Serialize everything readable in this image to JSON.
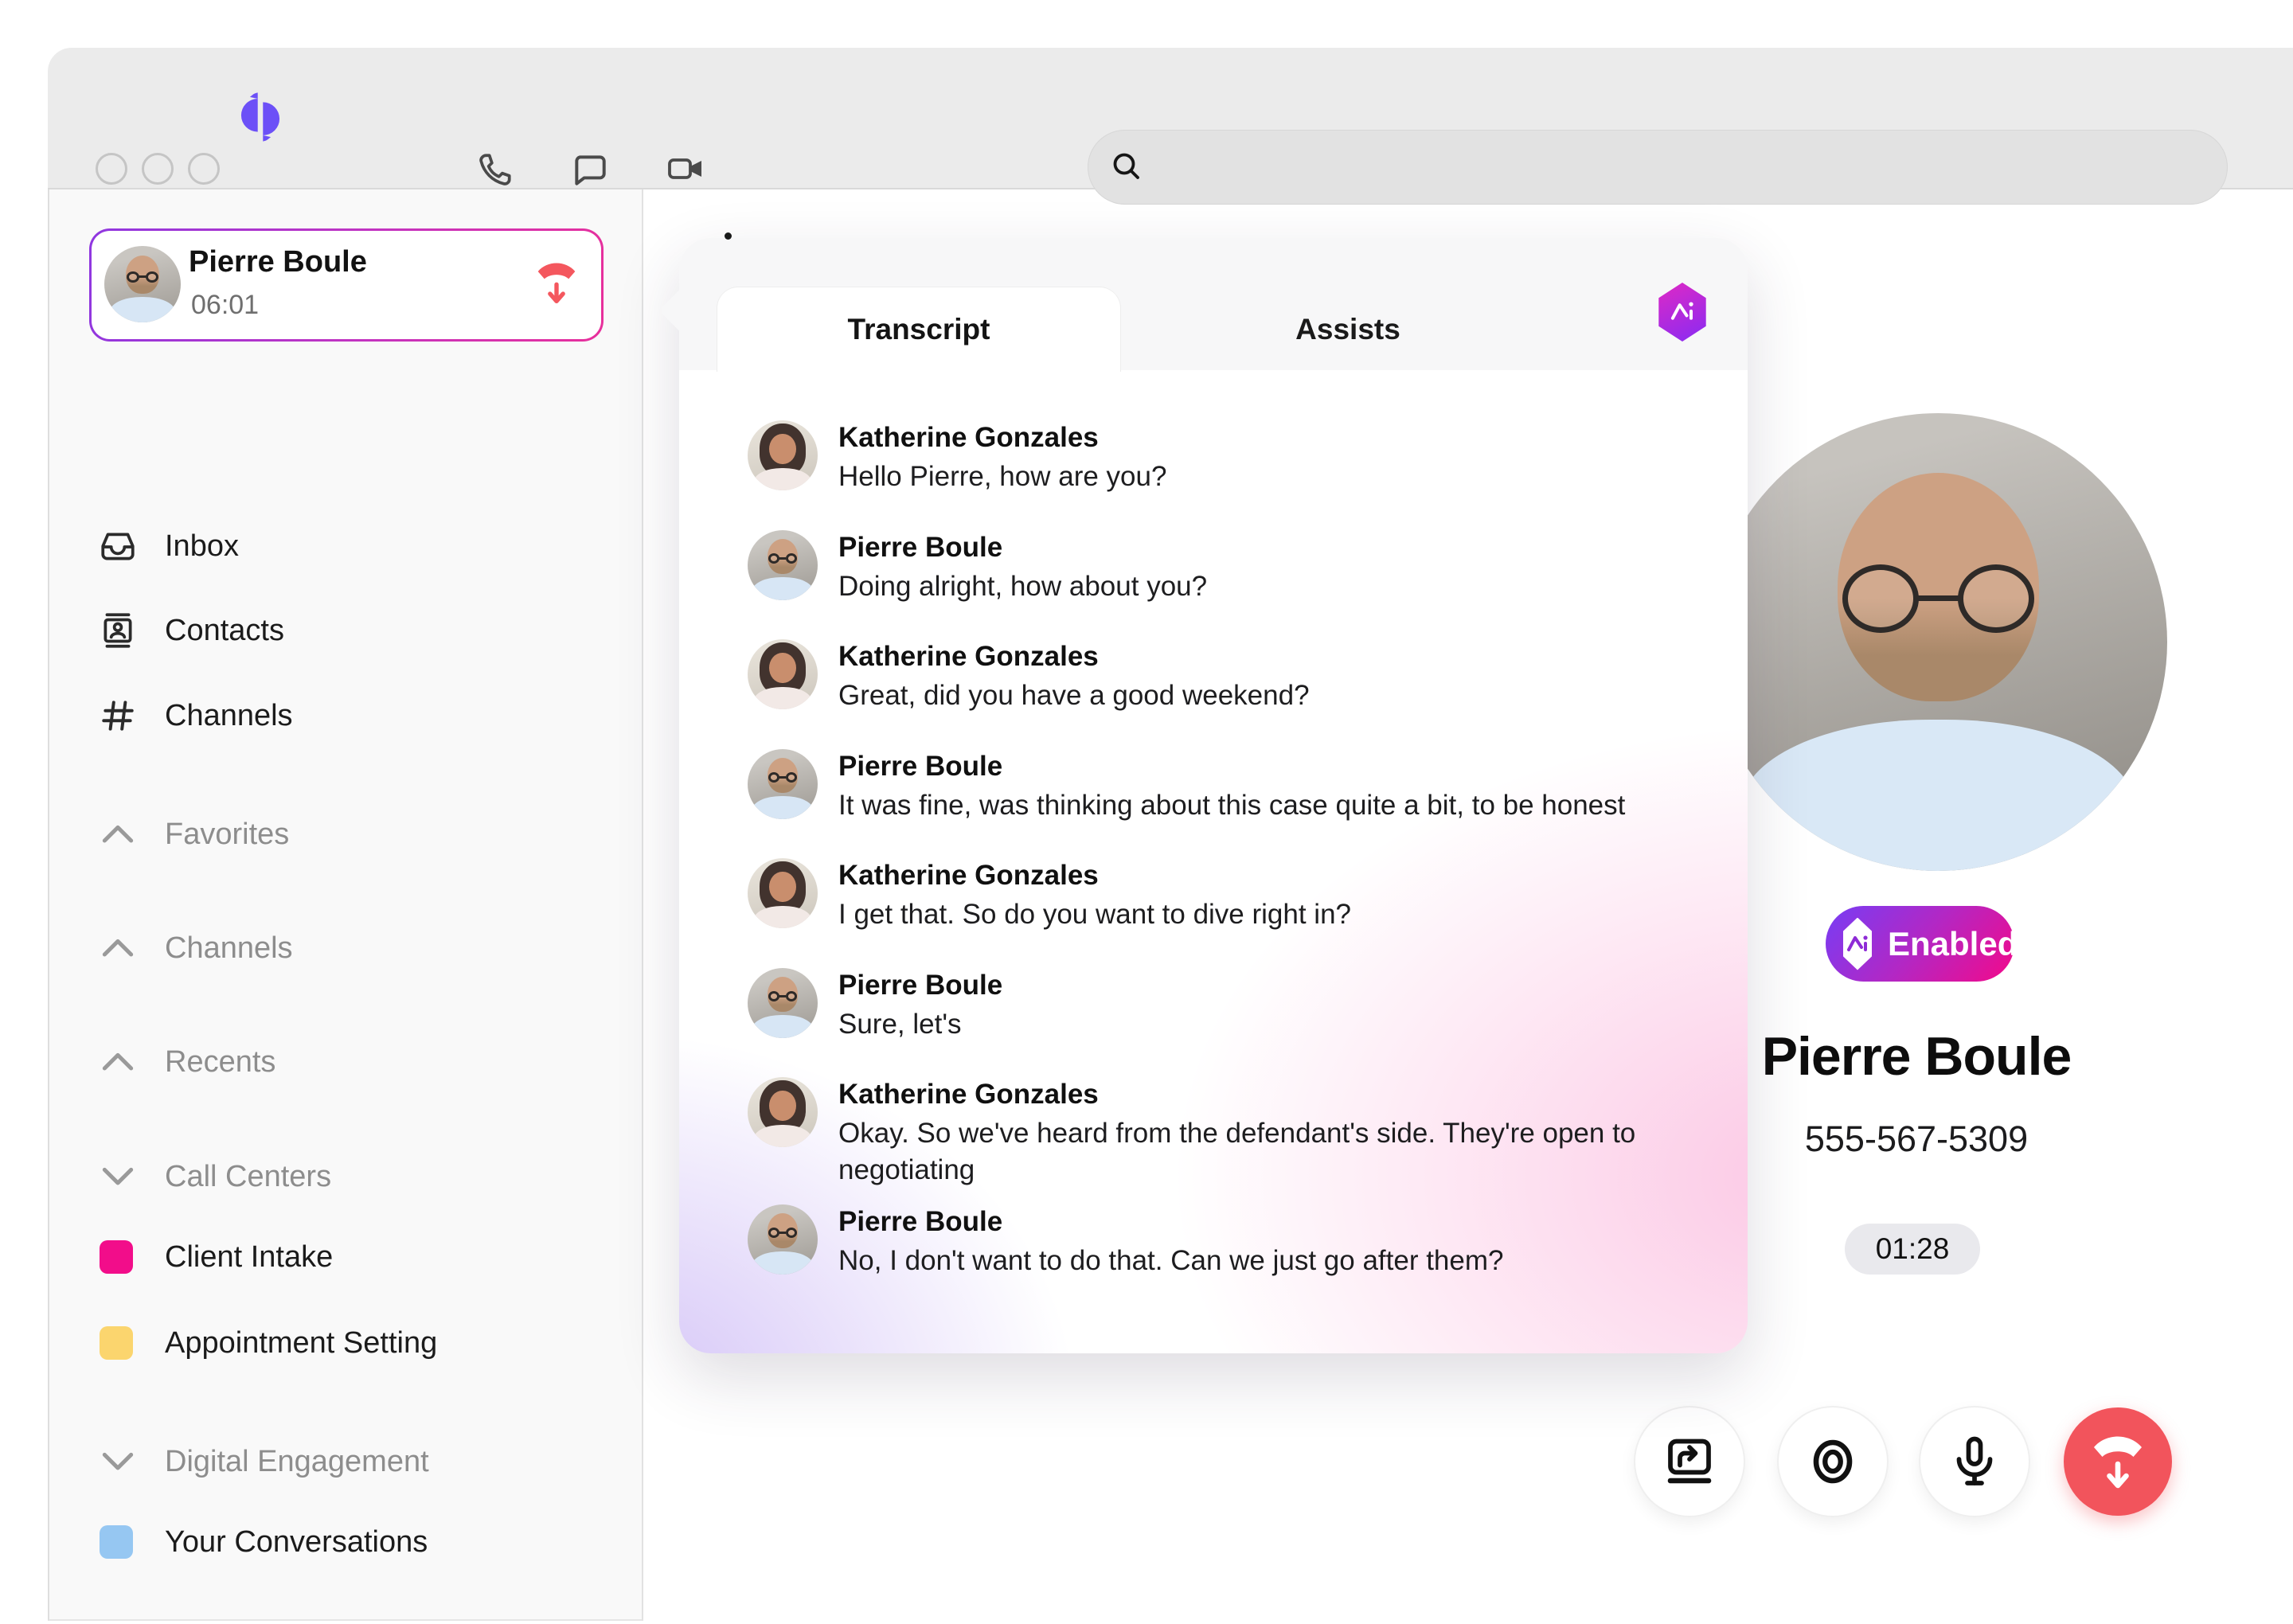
{
  "topbar": {
    "icons": [
      "phone-icon",
      "chat-icon",
      "video-icon"
    ],
    "search": {
      "placeholder": "",
      "value": ""
    }
  },
  "sidebar": {
    "active_call": {
      "name": "Pierre Boule",
      "time": "06:01",
      "action_icon": "hang-up-icon"
    },
    "nav": [
      {
        "label": "Inbox",
        "icon": "inbox-icon"
      },
      {
        "label": "Contacts",
        "icon": "contacts-icon"
      },
      {
        "label": "Channels",
        "icon": "hash-icon"
      }
    ],
    "sections": [
      {
        "label": "Favorites",
        "state": "expanded"
      },
      {
        "label": "Channels",
        "state": "expanded"
      },
      {
        "label": "Recents",
        "state": "expanded"
      },
      {
        "label": "Call Centers",
        "state": "collapsed"
      },
      {
        "label": "Digital Engagement",
        "state": "collapsed"
      }
    ],
    "call_center_items": [
      {
        "label": "Client Intake",
        "color": "#f20d8a"
      },
      {
        "label": "Appointment Setting",
        "color": "#fbd56e"
      }
    ],
    "digital_items": [
      {
        "label": "Your Conversations",
        "color": "#96c7f2"
      }
    ]
  },
  "transcript": {
    "tabs": [
      {
        "label": "Transcript",
        "active": true
      },
      {
        "label": "Assists",
        "active": false
      }
    ],
    "ai_icon": "ai-hexagon-icon",
    "messages": [
      {
        "speaker": "Katherine Gonzales",
        "text": "Hello Pierre, how are you?"
      },
      {
        "speaker": "Pierre Boule",
        "text": "Doing alright, how about you?"
      },
      {
        "speaker": "Katherine Gonzales",
        "text": "Great, did you have a good weekend?"
      },
      {
        "speaker": "Pierre Boule",
        "text": "It was fine, was thinking about this case quite a bit, to be honest"
      },
      {
        "speaker": "Katherine Gonzales",
        "text": "I get that. So do you want to dive right in?"
      },
      {
        "speaker": "Pierre Boule",
        "text": "Sure, let's"
      },
      {
        "speaker": "Katherine Gonzales",
        "text": "Okay. So we've heard from the defendant's side. They're open to negotiating"
      },
      {
        "speaker": "Pierre Boule",
        "text": "No, I don't want to do that. Can we just go after them?"
      }
    ]
  },
  "call_panel": {
    "ai_badge": {
      "label": "Enabled",
      "icon": "ai-hexagon-icon"
    },
    "contact_name": "Pierre Boule",
    "phone_number": "555-567-5309",
    "timer": "01:28",
    "controls": [
      {
        "icon": "share-screen-icon"
      },
      {
        "icon": "record-icon"
      },
      {
        "icon": "mic-icon"
      },
      {
        "icon": "end-call-icon"
      }
    ]
  },
  "colors": {
    "brand_purple": "#6c50f7",
    "badge_gradient_start": "#7d3bf0",
    "badge_gradient_end": "#ed0c8f",
    "end_call_red": "#f2545c",
    "client_intake": "#f20d8a",
    "appointment_setting": "#fbd56e",
    "your_conversations": "#96c7f2"
  }
}
